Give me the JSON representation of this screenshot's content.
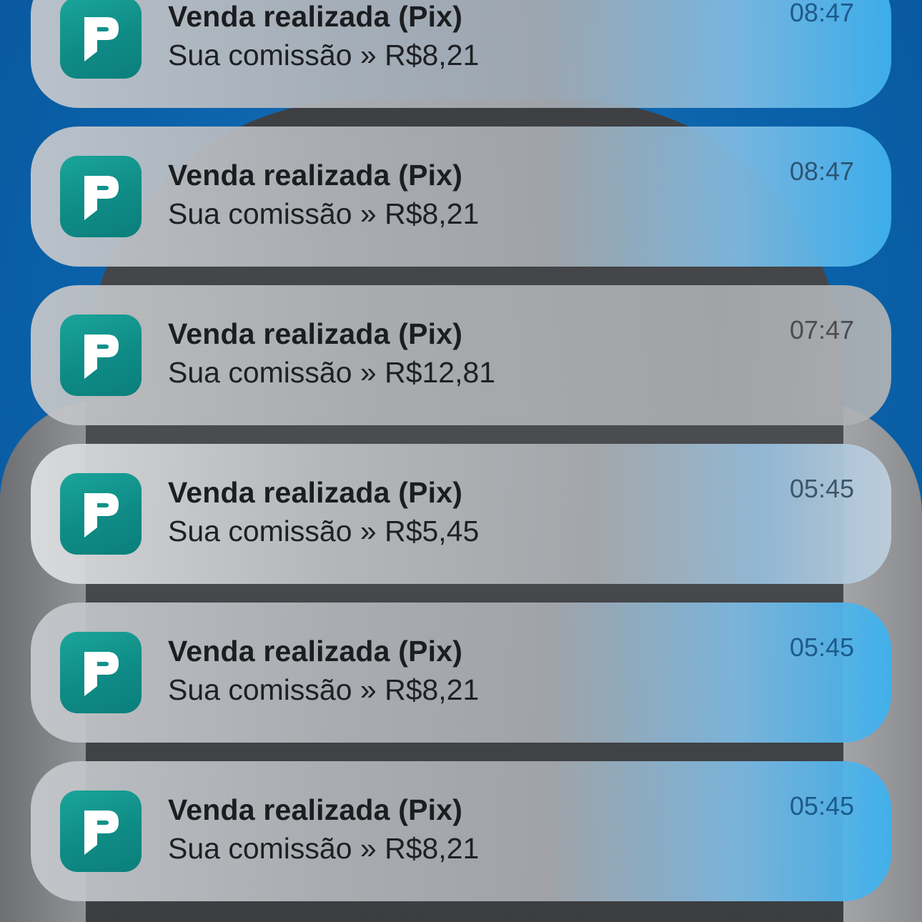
{
  "colors": {
    "app_icon": "#0f8b86",
    "title_text": "#1b1d20",
    "time_blue": "#1c5a8a",
    "time_gray": "#4a4c50",
    "background_blue": "#0b62aa"
  },
  "app_icon_name": "p-logo-icon",
  "notifications": [
    {
      "title": "Venda realizada (Pix)",
      "body": "Sua comissão » R$8,21",
      "time": "08:47"
    },
    {
      "title": "Venda realizada (Pix)",
      "body": "Sua comissão » R$8,21",
      "time": "08:47"
    },
    {
      "title": "Venda realizada (Pix)",
      "body": "Sua comissão » R$12,81",
      "time": "07:47"
    },
    {
      "title": "Venda realizada (Pix)",
      "body": "Sua comissão » R$5,45",
      "time": "05:45"
    },
    {
      "title": "Venda realizada (Pix)",
      "body": "Sua comissão » R$8,21",
      "time": "05:45"
    },
    {
      "title": "Venda realizada (Pix)",
      "body": "Sua comissão » R$8,21",
      "time": "05:45"
    }
  ]
}
